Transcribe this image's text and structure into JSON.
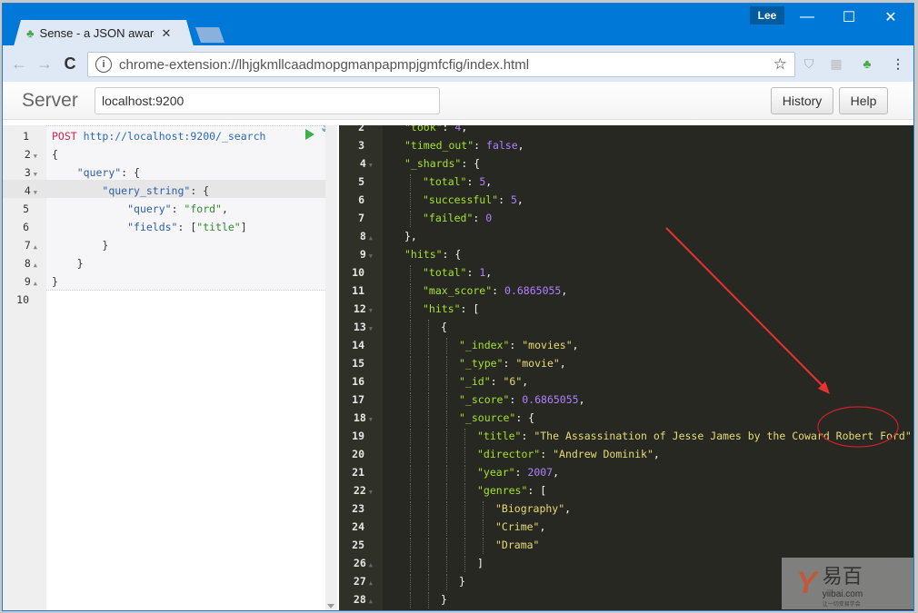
{
  "window": {
    "profile_name": "Lee",
    "controls": {
      "minimize": "—",
      "maximize": "☐",
      "close": "✕"
    }
  },
  "tabs": [
    {
      "title": "Sense - a JSON aware i",
      "favicon": "sense-tree-icon",
      "close": "✕",
      "active": true
    }
  ],
  "toolbar": {
    "back": "←",
    "forward": "→",
    "reload": "C",
    "url": "chrome-extension://lhjgkmllcaadmopgmanpapmpjgmfcfig/index.html",
    "info": "i",
    "star": "☆",
    "extensions": [
      {
        "name": "shield-extension",
        "glyph": "⛉"
      },
      {
        "name": "reader-extension",
        "glyph": "▦"
      },
      {
        "name": "sense-extension",
        "glyph": "♣"
      }
    ],
    "menu": "⋮"
  },
  "sense": {
    "server_label": "Server",
    "server_value": "localhost:9200",
    "history_label": "History",
    "help_label": "Help"
  },
  "request": {
    "lines": [
      {
        "n": "1",
        "fold": "",
        "parts": [
          [
            "k-method",
            "POST"
          ],
          [
            "k-punc",
            " "
          ],
          [
            "k-url",
            "http://localhost:9200/_search"
          ]
        ]
      },
      {
        "n": "2",
        "fold": "▼",
        "parts": [
          [
            "k-punc",
            "{"
          ]
        ]
      },
      {
        "n": "3",
        "fold": "▼",
        "parts": [
          [
            "k-punc",
            "    "
          ],
          [
            "k-key",
            "\"query\""
          ],
          [
            "k-punc",
            ": {"
          ]
        ]
      },
      {
        "n": "4",
        "fold": "▼",
        "parts": [
          [
            "k-punc",
            "        "
          ],
          [
            "k-key",
            "\"query_string\""
          ],
          [
            "k-punc",
            ": {"
          ]
        ]
      },
      {
        "n": "5",
        "fold": "",
        "parts": [
          [
            "k-punc",
            "            "
          ],
          [
            "k-key",
            "\"query\""
          ],
          [
            "k-punc",
            ": "
          ],
          [
            "k-str",
            "\"ford\""
          ],
          [
            "k-punc",
            ","
          ]
        ]
      },
      {
        "n": "6",
        "fold": "",
        "parts": [
          [
            "k-punc",
            "            "
          ],
          [
            "k-key",
            "\"fields\""
          ],
          [
            "k-punc",
            ": ["
          ],
          [
            "k-str",
            "\"title\""
          ],
          [
            "k-punc",
            "]"
          ]
        ]
      },
      {
        "n": "7",
        "fold": "▲",
        "parts": [
          [
            "k-punc",
            "        }"
          ]
        ]
      },
      {
        "n": "8",
        "fold": "▲",
        "parts": [
          [
            "k-punc",
            "    }"
          ]
        ]
      },
      {
        "n": "9",
        "fold": "▲",
        "parts": [
          [
            "k-punc",
            "}"
          ]
        ]
      },
      {
        "n": "10",
        "fold": "",
        "parts": []
      }
    ]
  },
  "response": {
    "lines": [
      {
        "n": "2",
        "fold": "",
        "indent": 1,
        "parts": [
          [
            "o-key",
            "\"took\""
          ],
          [
            "o-punc",
            ": "
          ],
          [
            "o-num",
            "4"
          ],
          [
            "o-punc",
            ","
          ]
        ]
      },
      {
        "n": "3",
        "fold": "",
        "indent": 1,
        "parts": [
          [
            "o-key",
            "\"timed_out\""
          ],
          [
            "o-punc",
            ": "
          ],
          [
            "o-num",
            "false"
          ],
          [
            "o-punc",
            ","
          ]
        ]
      },
      {
        "n": "4",
        "fold": "▼",
        "indent": 1,
        "parts": [
          [
            "o-key",
            "\"_shards\""
          ],
          [
            "o-punc",
            ": {"
          ]
        ]
      },
      {
        "n": "5",
        "fold": "",
        "indent": 2,
        "parts": [
          [
            "o-key",
            "\"total\""
          ],
          [
            "o-punc",
            ": "
          ],
          [
            "o-num",
            "5"
          ],
          [
            "o-punc",
            ","
          ]
        ]
      },
      {
        "n": "6",
        "fold": "",
        "indent": 2,
        "parts": [
          [
            "o-key",
            "\"successful\""
          ],
          [
            "o-punc",
            ": "
          ],
          [
            "o-num",
            "5"
          ],
          [
            "o-punc",
            ","
          ]
        ]
      },
      {
        "n": "7",
        "fold": "",
        "indent": 2,
        "parts": [
          [
            "o-key",
            "\"failed\""
          ],
          [
            "o-punc",
            ": "
          ],
          [
            "o-num",
            "0"
          ]
        ]
      },
      {
        "n": "8",
        "fold": "▲",
        "indent": 1,
        "parts": [
          [
            "o-punc",
            "},"
          ]
        ]
      },
      {
        "n": "9",
        "fold": "▼",
        "indent": 1,
        "parts": [
          [
            "o-key",
            "\"hits\""
          ],
          [
            "o-punc",
            ": {"
          ]
        ]
      },
      {
        "n": "10",
        "fold": "",
        "indent": 2,
        "parts": [
          [
            "o-key",
            "\"total\""
          ],
          [
            "o-punc",
            ": "
          ],
          [
            "o-num",
            "1"
          ],
          [
            "o-punc",
            ","
          ]
        ]
      },
      {
        "n": "11",
        "fold": "",
        "indent": 2,
        "parts": [
          [
            "o-key",
            "\"max_score\""
          ],
          [
            "o-punc",
            ": "
          ],
          [
            "o-num",
            "0.6865055"
          ],
          [
            "o-punc",
            ","
          ]
        ]
      },
      {
        "n": "12",
        "fold": "▼",
        "indent": 2,
        "parts": [
          [
            "o-key",
            "\"hits\""
          ],
          [
            "o-punc",
            ": ["
          ]
        ]
      },
      {
        "n": "13",
        "fold": "▼",
        "indent": 3,
        "parts": [
          [
            "o-punc",
            "{"
          ]
        ]
      },
      {
        "n": "14",
        "fold": "",
        "indent": 4,
        "parts": [
          [
            "o-key",
            "\"_index\""
          ],
          [
            "o-punc",
            ": "
          ],
          [
            "o-str",
            "\"movies\""
          ],
          [
            "o-punc",
            ","
          ]
        ]
      },
      {
        "n": "15",
        "fold": "",
        "indent": 4,
        "parts": [
          [
            "o-key",
            "\"_type\""
          ],
          [
            "o-punc",
            ": "
          ],
          [
            "o-str",
            "\"movie\""
          ],
          [
            "o-punc",
            ","
          ]
        ]
      },
      {
        "n": "16",
        "fold": "",
        "indent": 4,
        "parts": [
          [
            "o-key",
            "\"_id\""
          ],
          [
            "o-punc",
            ": "
          ],
          [
            "o-str",
            "\"6\""
          ],
          [
            "o-punc",
            ","
          ]
        ]
      },
      {
        "n": "17",
        "fold": "",
        "indent": 4,
        "parts": [
          [
            "o-key",
            "\"_score\""
          ],
          [
            "o-punc",
            ": "
          ],
          [
            "o-num",
            "0.6865055"
          ],
          [
            "o-punc",
            ","
          ]
        ]
      },
      {
        "n": "18",
        "fold": "▼",
        "indent": 4,
        "parts": [
          [
            "o-key",
            "\"_source\""
          ],
          [
            "o-punc",
            ": {"
          ]
        ]
      },
      {
        "n": "19",
        "fold": "",
        "indent": 5,
        "parts": [
          [
            "o-key",
            "\"title\""
          ],
          [
            "o-punc",
            ": "
          ],
          [
            "o-str",
            "\"The Assassination of Jesse James by the Coward Robert Ford\""
          ],
          [
            "o-punc",
            ","
          ]
        ]
      },
      {
        "n": "20",
        "fold": "",
        "indent": 5,
        "parts": [
          [
            "o-key",
            "\"director\""
          ],
          [
            "o-punc",
            ": "
          ],
          [
            "o-str",
            "\"Andrew Dominik\""
          ],
          [
            "o-punc",
            ","
          ]
        ]
      },
      {
        "n": "21",
        "fold": "",
        "indent": 5,
        "parts": [
          [
            "o-key",
            "\"year\""
          ],
          [
            "o-punc",
            ": "
          ],
          [
            "o-num",
            "2007"
          ],
          [
            "o-punc",
            ","
          ]
        ]
      },
      {
        "n": "22",
        "fold": "▼",
        "indent": 5,
        "parts": [
          [
            "o-key",
            "\"genres\""
          ],
          [
            "o-punc",
            ": ["
          ]
        ]
      },
      {
        "n": "23",
        "fold": "",
        "indent": 6,
        "parts": [
          [
            "o-str",
            "\"Biography\""
          ],
          [
            "o-punc",
            ","
          ]
        ]
      },
      {
        "n": "24",
        "fold": "",
        "indent": 6,
        "parts": [
          [
            "o-str",
            "\"Crime\""
          ],
          [
            "o-punc",
            ","
          ]
        ]
      },
      {
        "n": "25",
        "fold": "",
        "indent": 6,
        "parts": [
          [
            "o-str",
            "\"Drama\""
          ]
        ]
      },
      {
        "n": "26",
        "fold": "▲",
        "indent": 5,
        "parts": [
          [
            "o-punc",
            "]"
          ]
        ]
      },
      {
        "n": "27",
        "fold": "▲",
        "indent": 4,
        "parts": [
          [
            "o-punc",
            "}"
          ]
        ]
      },
      {
        "n": "28",
        "fold": "▲",
        "indent": 3,
        "parts": [
          [
            "o-punc",
            "}"
          ]
        ]
      }
    ]
  },
  "annotation": {
    "arrow_color": "#e8322e",
    "highlight_text": "Robert Ford"
  },
  "watermark": {
    "logo": "Y",
    "name_cn": "易百",
    "url": "yiibai.com",
    "slogan": "让一切变易学会"
  }
}
